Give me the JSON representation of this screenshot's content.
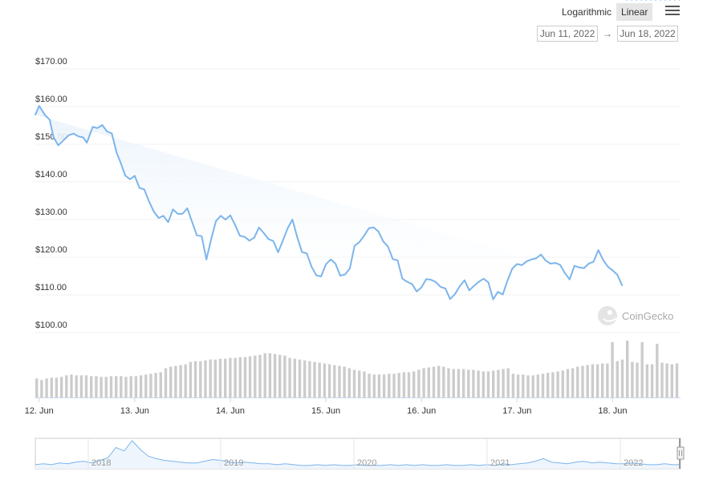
{
  "toolbar": {
    "scale_options": [
      "Logarithmic",
      "Linear"
    ],
    "active_scale": "Linear",
    "menu_icon": "hamburger-icon",
    "date_from": "Jun 11, 2022",
    "date_arrow": "→",
    "date_to": "Jun 18, 2022"
  },
  "watermark": {
    "text": "CoinGecko",
    "icon": "gecko-logo-icon"
  },
  "colors": {
    "line": "#7cb5ec",
    "area": "#eaf3fc",
    "volume": "#cccccc",
    "grid": "#f0f0f0"
  },
  "chart_data": [
    {
      "type": "line",
      "y_ticks": [
        "$100.00",
        "$110.00",
        "$120.00",
        "$130.00",
        "$140.00",
        "$150.00",
        "$160.00",
        "$170.00"
      ],
      "ylim": [
        100,
        170
      ],
      "x_ticks": [
        "12. Jun",
        "13. Jun",
        "14. Jun",
        "15. Jun",
        "16. Jun",
        "17. Jun",
        "18. Jun"
      ],
      "xlim": [
        11.96,
        18.71
      ],
      "x": [
        11.96,
        12.0,
        12.06,
        12.11,
        12.15,
        12.2,
        12.26,
        12.31,
        12.36,
        12.41,
        12.46,
        12.5,
        12.56,
        12.61,
        12.66,
        12.71,
        12.76,
        12.81,
        12.85,
        12.9,
        12.95,
        13.0,
        13.05,
        13.1,
        13.15,
        13.2,
        13.25,
        13.3,
        13.35,
        13.4,
        13.45,
        13.5,
        13.55,
        13.6,
        13.65,
        13.7,
        13.75,
        13.8,
        13.85,
        13.9,
        13.95,
        14.0,
        14.05,
        14.1,
        14.15,
        14.2,
        14.25,
        14.3,
        14.35,
        14.4,
        14.45,
        14.5,
        14.55,
        14.6,
        14.65,
        14.7,
        14.75,
        14.8,
        14.85,
        14.9,
        14.95,
        15.0,
        15.05,
        15.1,
        15.15,
        15.2,
        15.25,
        15.3,
        15.35,
        15.4,
        15.45,
        15.5,
        15.55,
        15.6,
        15.65,
        15.7,
        15.75,
        15.8,
        15.85,
        15.9,
        15.95,
        16.0,
        16.05,
        16.1,
        16.15,
        16.2,
        16.25,
        16.3,
        16.35,
        16.4,
        16.45,
        16.5,
        16.55,
        16.6,
        16.65,
        16.7,
        16.75,
        16.8,
        16.85,
        16.9,
        16.95,
        17.0,
        17.05,
        17.1,
        17.15,
        17.2,
        17.25,
        17.3,
        17.35,
        17.4,
        17.45,
        17.5,
        17.55,
        17.6,
        17.65,
        17.7,
        17.75,
        17.8,
        17.85,
        17.9,
        17.95,
        18.0,
        18.05,
        18.1,
        18.15,
        18.2,
        18.25,
        18.3,
        18.35,
        18.4,
        18.45,
        18.5,
        18.55,
        18.6,
        18.65,
        18.7
      ],
      "values": [
        157.8,
        160.2,
        157.8,
        156.5,
        151.9,
        149.7,
        151.2,
        152.4,
        152.8,
        152.1,
        151.8,
        150.4,
        154.6,
        154.3,
        155.1,
        153.4,
        152.9,
        147.8,
        145.3,
        141.7,
        140.7,
        141.6,
        138.4,
        138.0,
        134.8,
        132.1,
        130.4,
        131.0,
        129.3,
        132.7,
        131.5,
        131.5,
        133.0,
        129.4,
        125.8,
        125.6,
        119.4,
        124.8,
        129.6,
        131.0,
        130.0,
        131.1,
        128.6,
        125.7,
        125.4,
        124.4,
        125.2,
        127.9,
        126.4,
        124.8,
        124.3,
        121.3,
        124.4,
        127.7,
        130.0,
        125.3,
        121.4,
        121.0,
        117.5,
        115.2,
        114.9,
        118.1,
        119.4,
        118.3,
        115.1,
        115.4,
        117.0,
        123.0,
        124.0,
        125.7,
        127.7,
        127.9,
        126.8,
        124.2,
        122.8,
        119.5,
        119.2,
        114.3,
        113.5,
        112.9,
        110.9,
        112.0,
        114.2,
        114.0,
        113.4,
        112.1,
        111.7,
        108.9,
        110.2,
        112.3,
        113.9,
        111.2,
        112.4,
        113.5,
        114.3,
        113.3,
        108.8,
        110.8,
        110.1,
        113.8,
        117.0,
        118.2,
        117.9,
        118.9,
        119.4,
        119.7,
        120.7,
        119.1,
        118.3,
        118.5,
        118.0,
        115.8,
        114.1,
        117.7,
        117.3,
        117.1,
        118.3,
        118.8,
        121.9,
        119.3,
        117.5,
        116.5,
        115.3,
        112.5
      ]
    },
    {
      "type": "bar",
      "series": [
        {
          "values": [
            24,
            22,
            24,
            25,
            25,
            26,
            28,
            29,
            28,
            28,
            28,
            27,
            27,
            26,
            26,
            27,
            27,
            27,
            26,
            27,
            27,
            28,
            29,
            30,
            31,
            32,
            37,
            39,
            40,
            41,
            42,
            45,
            46,
            46,
            47,
            48,
            48,
            49,
            49,
            50,
            50,
            51,
            51,
            52,
            53,
            54,
            56,
            56,
            55,
            54,
            53,
            50,
            49,
            48,
            47,
            46,
            45,
            44,
            43,
            42,
            41,
            40,
            39,
            37,
            35,
            34,
            33,
            30,
            29,
            29,
            29,
            30,
            30,
            31,
            32,
            32,
            33,
            35,
            37,
            38,
            39,
            40,
            39,
            37,
            36,
            36,
            36,
            35,
            35,
            34,
            33,
            33,
            34,
            35,
            36,
            37,
            30,
            29,
            29,
            28,
            28,
            29,
            30,
            31,
            32,
            33,
            34,
            36,
            37,
            39,
            40,
            41,
            42,
            42,
            43,
            43,
            70,
            46,
            48,
            72,
            45,
            44,
            70,
            42,
            42,
            68,
            44,
            43,
            42,
            43
          ]
        }
      ]
    },
    {
      "type": "line",
      "x_ticks": [
        "2018",
        "2019",
        "2020",
        "2021",
        "2022"
      ],
      "values": [
        2,
        3,
        2,
        4,
        3,
        5,
        6,
        4,
        7,
        10,
        22,
        18,
        30,
        20,
        12,
        9,
        7,
        6,
        5,
        4,
        4,
        6,
        8,
        7,
        5,
        4,
        5,
        4,
        3,
        3,
        2,
        3,
        2,
        1,
        1,
        2,
        1,
        2,
        1,
        1,
        2,
        1,
        1,
        1,
        2,
        1,
        2,
        1,
        2,
        1,
        1,
        2,
        1,
        1,
        2,
        1,
        2,
        1,
        3,
        2,
        3,
        4,
        6,
        9,
        5,
        4,
        3,
        5,
        6,
        4,
        5,
        4,
        3,
        3,
        4,
        3,
        2,
        2,
        3,
        2,
        2
      ]
    }
  ]
}
